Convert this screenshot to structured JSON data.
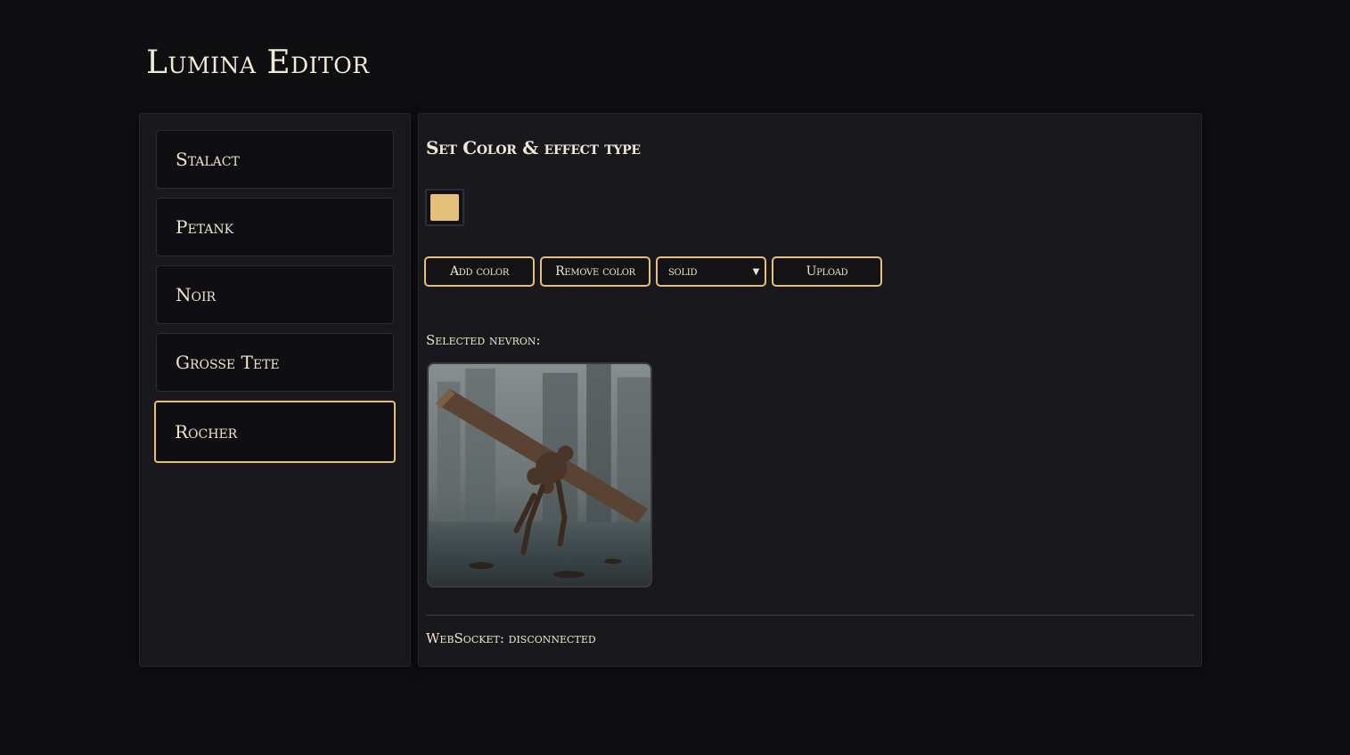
{
  "app": {
    "title": "Lumina Editor"
  },
  "sidebar": {
    "items": [
      {
        "label": "Stalact"
      },
      {
        "label": "Petank"
      },
      {
        "label": "Noir"
      },
      {
        "label": "Grosse Tete"
      },
      {
        "label": "Rocher",
        "selected": true
      }
    ]
  },
  "main": {
    "title": "Set Color & effect type",
    "swatch_color": "#e4c17b",
    "buttons": {
      "add_color": "Add color",
      "remove_color": "Remove color",
      "effect_selected": "solid",
      "upload": "Upload"
    },
    "selected_label": "Selected nevron:",
    "status": "WebSocket: disconnected"
  },
  "colors": {
    "accent": "#e4c07a",
    "panel": "#18181d",
    "background": "#0f0f12"
  }
}
